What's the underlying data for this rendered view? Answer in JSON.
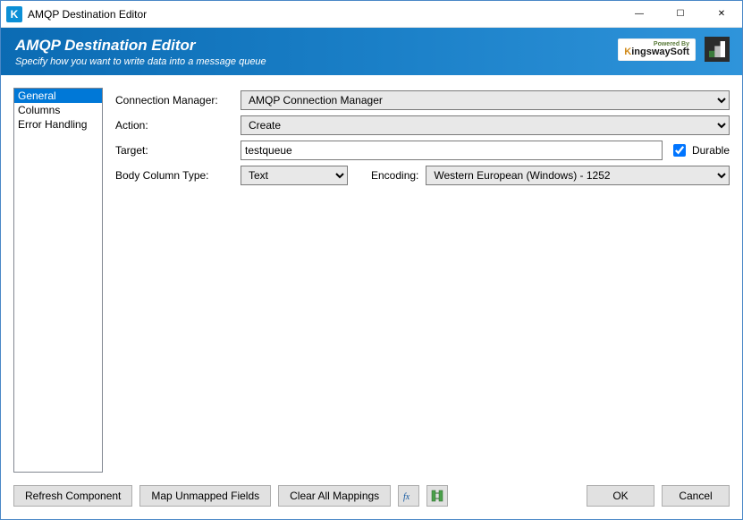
{
  "window": {
    "title": "AMQP Destination Editor"
  },
  "banner": {
    "title": "AMQP Destination Editor",
    "subtitle": "Specify how you want to write data into a message queue",
    "powered_by": "Powered By",
    "brand_k": "K",
    "brand_rest": "ingswaySoft"
  },
  "nav": {
    "items": [
      {
        "label": "General",
        "selected": true
      },
      {
        "label": "Columns",
        "selected": false
      },
      {
        "label": "Error Handling",
        "selected": false
      }
    ]
  },
  "form": {
    "conn_mgr_label": "Connection Manager:",
    "conn_mgr_value": "AMQP Connection Manager",
    "action_label": "Action:",
    "action_value": "Create",
    "target_label": "Target:",
    "target_value": "testqueue",
    "durable_label": "Durable",
    "durable_checked": true,
    "body_type_label": "Body Column Type:",
    "body_type_value": "Text",
    "encoding_label": "Encoding:",
    "encoding_value": "Western European (Windows) - 1252"
  },
  "footer": {
    "refresh": "Refresh Component",
    "map_unmapped": "Map Unmapped Fields",
    "clear_all": "Clear All Mappings",
    "ok": "OK",
    "cancel": "Cancel"
  }
}
